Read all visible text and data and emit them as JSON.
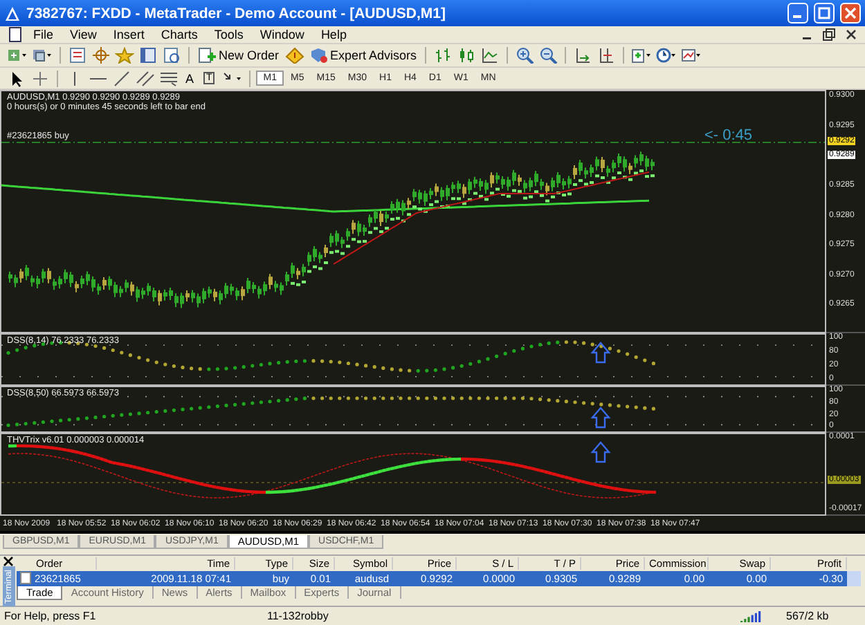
{
  "window": {
    "title": "7382767: FXDD - MetaTrader - Demo Account - [AUDUSD,M1]"
  },
  "menu": [
    "File",
    "View",
    "Insert",
    "Charts",
    "Tools",
    "Window",
    "Help"
  ],
  "toolbar": {
    "new_order": "New Order",
    "expert_advisors": "Expert Advisors"
  },
  "drawing_tools": {
    "text": "A",
    "text_label": "T"
  },
  "timeframes": [
    {
      "label": "M1",
      "selected": true
    },
    {
      "label": "M5",
      "selected": false
    },
    {
      "label": "M15",
      "selected": false
    },
    {
      "label": "M30",
      "selected": false
    },
    {
      "label": "H1",
      "selected": false
    },
    {
      "label": "H4",
      "selected": false
    },
    {
      "label": "D1",
      "selected": false
    },
    {
      "label": "W1",
      "selected": false
    },
    {
      "label": "MN",
      "selected": false
    }
  ],
  "chart": {
    "header": "AUDUSD,M1  0.9290 0.9290 0.9289 0.9289",
    "bar_timer": "0 hours(s) or 0 minutes 45 seconds left to bar end",
    "order_label": "#23621865 buy",
    "countdown": "<- 0:45",
    "price_ticks": [
      "0.9300",
      "0.9295",
      "0.9285",
      "0.9280",
      "0.9275",
      "0.9270",
      "0.9265"
    ],
    "price_badges": [
      {
        "text": "0.9292",
        "kind": "ask"
      },
      {
        "text": "0.9289",
        "kind": "bid"
      }
    ],
    "indicators": [
      {
        "kind": "dots",
        "label": "DSS(8,14) 76.2333 76.2333",
        "axis": [
          "100",
          "80",
          "20",
          "0"
        ]
      },
      {
        "kind": "dots",
        "label": "DSS(8,50) 66.5973 66.5973",
        "axis": [
          "100",
          "80",
          "20",
          "0"
        ]
      },
      {
        "kind": "lines",
        "label": "THVTrix v6.01 0.000003 0.000014",
        "axis": [
          "0.0001",
          "-0.00017"
        ],
        "badge": "0.00003"
      }
    ],
    "time_axis": [
      "18 Nov 2009",
      "18 Nov 05:52",
      "18 Nov 06:02",
      "18 Nov 06:10",
      "18 Nov 06:20",
      "18 Nov 06:29",
      "18 Nov 06:42",
      "18 Nov 06:54",
      "18 Nov 07:04",
      "18 Nov 07:13",
      "18 Nov 07:30",
      "18 Nov 07:38",
      "18 Nov 07:47"
    ]
  },
  "chart_tabs": [
    {
      "label": "GBPUSD,M1",
      "selected": false
    },
    {
      "label": "EURUSD,M1",
      "selected": false
    },
    {
      "label": "USDJPY,M1",
      "selected": false
    },
    {
      "label": "AUDUSD,M1",
      "selected": true
    },
    {
      "label": "USDCHF,M1",
      "selected": false
    }
  ],
  "terminal": {
    "side_label": "Terminal",
    "columns": [
      "Order",
      "Time",
      "Type",
      "Size",
      "Symbol",
      "Price",
      "S / L",
      "T / P",
      "Price",
      "Commission",
      "Swap",
      "Profit"
    ],
    "rows": [
      {
        "cells": [
          "23621865",
          "2009.11.18 07:41",
          "buy",
          "0.01",
          "audusd",
          "0.9292",
          "0.0000",
          "0.9305",
          "0.9289",
          "0.00",
          "0.00",
          "-0.30"
        ],
        "selected": true
      }
    ],
    "tabs": [
      {
        "label": "Trade",
        "selected": true
      },
      {
        "label": "Account History",
        "selected": false
      },
      {
        "label": "News",
        "selected": false
      },
      {
        "label": "Alerts",
        "selected": false
      },
      {
        "label": "Mailbox",
        "selected": false
      },
      {
        "label": "Experts",
        "selected": false
      },
      {
        "label": "Journal",
        "selected": false
      }
    ]
  },
  "status_bar": [
    "For Help, press F1",
    "11-132robby",
    "567/2 kb"
  ]
}
